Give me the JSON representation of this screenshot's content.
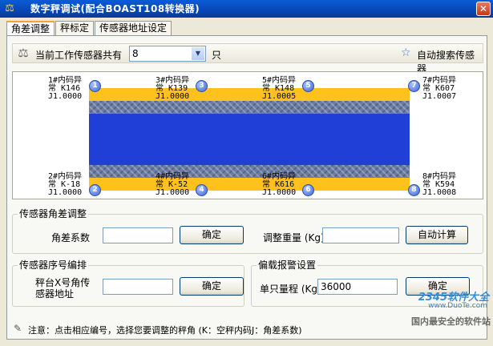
{
  "window": {
    "title": "数字秤调试(配合BOAST108转换器)",
    "close_glyph": "✕"
  },
  "tabs": [
    {
      "label": "角差调整",
      "active": true
    },
    {
      "label": "秤标定",
      "active": false
    },
    {
      "label": "传感器地址设定",
      "active": false
    }
  ],
  "toolbar": {
    "sensor_count_label": "当前工作传感器共有",
    "sensor_count_value": "8",
    "unit": "只",
    "auto_search_label": "自动搜索传感器"
  },
  "sensors": [
    {
      "num": "1",
      "lines": [
        "1#内码异",
        "常 K146",
        "J1.0000"
      ]
    },
    {
      "num": "3",
      "lines": [
        "3#内码异",
        "常 K139",
        "J1.0000"
      ]
    },
    {
      "num": "5",
      "lines": [
        "5#内码异",
        "常 K148",
        "J1.0005"
      ]
    },
    {
      "num": "7",
      "lines": [
        "7#内码异",
        "常 K607",
        "J1.0007"
      ]
    },
    {
      "num": "2",
      "lines": [
        "2#内码异",
        "常 K-18",
        "J1.0000"
      ]
    },
    {
      "num": "4",
      "lines": [
        "4#内码异",
        "常 K-52",
        "J1.0000"
      ]
    },
    {
      "num": "6",
      "lines": [
        "6#内码异",
        "常 K616",
        "J1.0000"
      ]
    },
    {
      "num": "8",
      "lines": [
        "8#内码异",
        "常 K594",
        "J1.0008"
      ]
    }
  ],
  "angle_group": {
    "legend": "传感器角差调整",
    "coef_label": "角差系数",
    "coef_value": "",
    "confirm_label": "确定",
    "weight_label": "调整重量 (Kg)",
    "weight_value": "",
    "auto_calc_label": "自动计算"
  },
  "order_group": {
    "legend": "传感器序号编排",
    "addr_label_line1": "秤台X号角传",
    "addr_label_line2": "感器地址",
    "addr_value": "",
    "confirm_label": "确定"
  },
  "alarm_group": {
    "legend": "偏载报警设置",
    "range_label": "单只量程 (Kg)",
    "range_value": "36000",
    "confirm_label": "确定"
  },
  "note": "注意：点击相应编号，选择您要调整的秤角 (K：空秤内码J：角差系数)",
  "watermark": {
    "brand": "2345软件大全",
    "url": "www.DuoTe.com",
    "slogan": "国内最安全的软件站"
  }
}
